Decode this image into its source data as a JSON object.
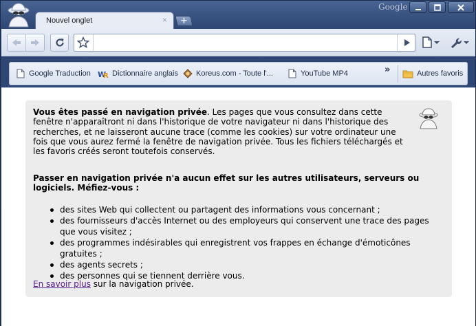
{
  "window": {
    "brand": "Google",
    "buttons": [
      "minimize",
      "maximize",
      "close"
    ]
  },
  "tab": {
    "title": "Nouvel onglet",
    "close_glyph": "×",
    "new_tab_glyph": "+"
  },
  "toolbar": {
    "back_icon": "back-arrow-icon",
    "forward_icon": "forward-arrow-icon",
    "reload_icon": "reload-icon",
    "star_icon": "star-icon",
    "url_value": "",
    "go_icon": "play-arrow-icon",
    "page_menu_icon": "page-icon",
    "tools_menu_icon": "wrench-icon"
  },
  "bookmarks": {
    "items": [
      {
        "label": "Google Traduction",
        "icon": "page-icon"
      },
      {
        "label": "Dictionnaire anglais",
        "icon": "wr-logo-icon"
      },
      {
        "label": "Koreus.com - Toute l'...",
        "icon": "koreus-icon"
      },
      {
        "label": "YouTube MP4",
        "icon": "page-icon"
      }
    ],
    "more_glyph": "»",
    "other_label": "Autres favoris"
  },
  "incognito": {
    "intro_bold": "Vous êtes passé en navigation privée",
    "intro_rest": ". Les pages que vous consultez dans cette fenêtre n'apparaîtront ni dans l'historique de votre navigateur ni dans l'historique des recherches, et ne laisseront aucune trace (comme les cookies) sur votre ordinateur une fois que vous aurez fermé la fenêtre de navigation privée. Tous les fichiers téléchargés et les favoris créés seront toutefois conservés.",
    "warning": "Passer en navigation privée n'a aucun effet sur les autres utilisateurs, serveurs ou logiciels. Méfiez-vous :",
    "bullets": [
      "des sites Web qui collectent ou partagent des informations vous concernant ;",
      "des fournisseurs d'accès Internet ou des employeurs qui conservent une trace des pages que vous visitez ;",
      "des programmes indésirables qui enregistrent vos frappes en échange d'émoticônes gratuites ;",
      "des agents secrets ;",
      "des personnes qui se tiennent derrière vous."
    ],
    "learn_more_link": "En savoir plus",
    "learn_more_rest": " sur la navigation privée."
  }
}
